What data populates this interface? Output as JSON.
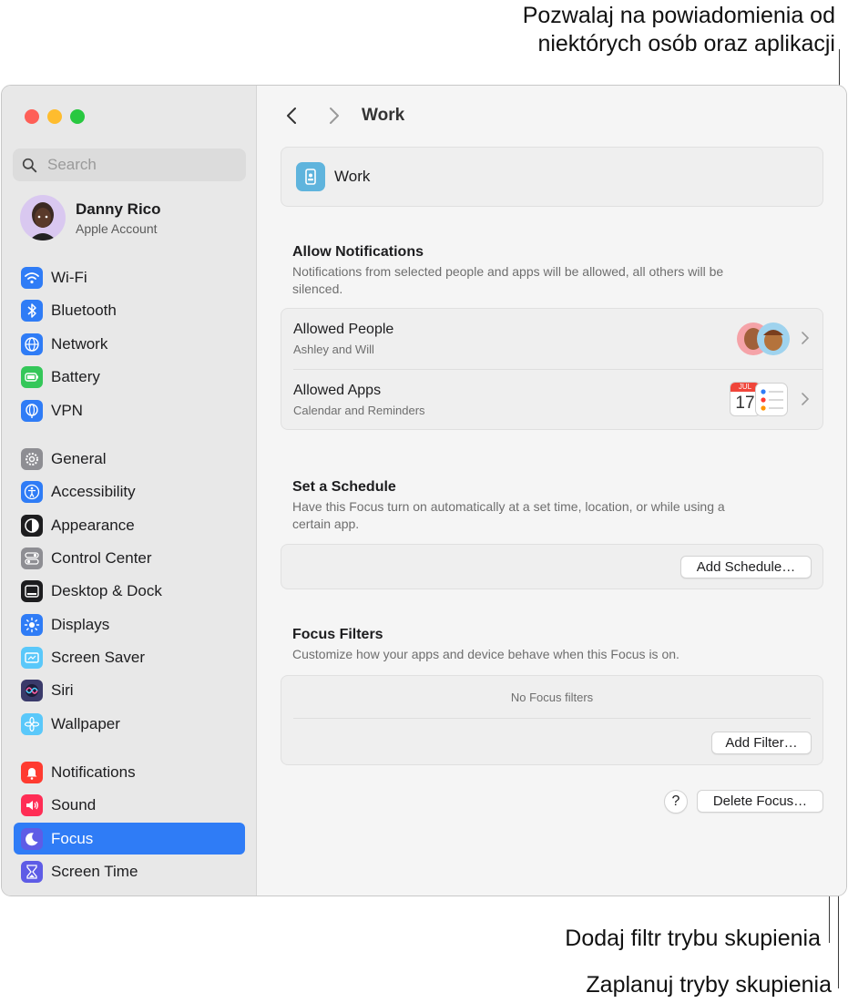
{
  "callouts": {
    "top_line1": "Pozwalaj na powiadomienia od",
    "top_line2": "niektórych osób oraz aplikacji",
    "filter": "Dodaj filtr trybu skupienia",
    "schedule": "Zaplanuj tryby skupienia"
  },
  "sidebar": {
    "search_placeholder": "Search",
    "account": {
      "name": "Danny Rico",
      "subtitle": "Apple Account"
    },
    "items": [
      {
        "label": "Wi-Fi",
        "icon": "wifi-icon",
        "color": "#2f7cf6"
      },
      {
        "label": "Bluetooth",
        "icon": "bluetooth-icon",
        "color": "#2f7cf6"
      },
      {
        "label": "Network",
        "icon": "globe-icon",
        "color": "#2f7cf6"
      },
      {
        "label": "Battery",
        "icon": "battery-icon",
        "color": "#34c759"
      },
      {
        "label": "VPN",
        "icon": "vpn-globe-icon",
        "color": "#2f7cf6"
      },
      {
        "label": "General",
        "icon": "gear-icon",
        "color": "#8e8e93"
      },
      {
        "label": "Accessibility",
        "icon": "accessibility-icon",
        "color": "#2f7cf6"
      },
      {
        "label": "Appearance",
        "icon": "appearance-icon",
        "color": "#1d1d1f"
      },
      {
        "label": "Control Center",
        "icon": "toggles-icon",
        "color": "#8e8e93"
      },
      {
        "label": "Desktop & Dock",
        "icon": "dock-icon",
        "color": "#1d1d1f"
      },
      {
        "label": "Displays",
        "icon": "sun-icon",
        "color": "#2f7cf6"
      },
      {
        "label": "Screen Saver",
        "icon": "screen-saver-icon",
        "color": "#5ac8fa"
      },
      {
        "label": "Siri",
        "icon": "siri-icon",
        "color": "#3a3a6a"
      },
      {
        "label": "Wallpaper",
        "icon": "flower-icon",
        "color": "#5ac8fa"
      },
      {
        "label": "Notifications",
        "icon": "bell-icon",
        "color": "#ff3b30"
      },
      {
        "label": "Sound",
        "icon": "speaker-icon",
        "color": "#ff2d55"
      },
      {
        "label": "Focus",
        "icon": "moon-icon",
        "color": "#5e5ce6"
      },
      {
        "label": "Screen Time",
        "icon": "hourglass-icon",
        "color": "#5e5ce6"
      }
    ],
    "selected": "Focus"
  },
  "main": {
    "title": "Work",
    "focus_card_label": "Work",
    "allow": {
      "title": "Allow Notifications",
      "desc": "Notifications from selected people and apps will be allowed, all others will be silenced.",
      "people_title": "Allowed People",
      "people_sub": "Ashley and Will",
      "apps_title": "Allowed Apps",
      "apps_sub": "Calendar and Reminders",
      "calendar_month": "JUL",
      "calendar_day": "17"
    },
    "schedule": {
      "title": "Set a Schedule",
      "desc": "Have this Focus turn on automatically at a set time, location, or while using a certain app.",
      "button": "Add Schedule…"
    },
    "filters": {
      "title": "Focus Filters",
      "desc": "Customize how your apps and device behave when this Focus is on.",
      "empty": "No Focus filters",
      "button": "Add Filter…"
    },
    "help_label": "?",
    "delete_button": "Delete Focus…"
  }
}
